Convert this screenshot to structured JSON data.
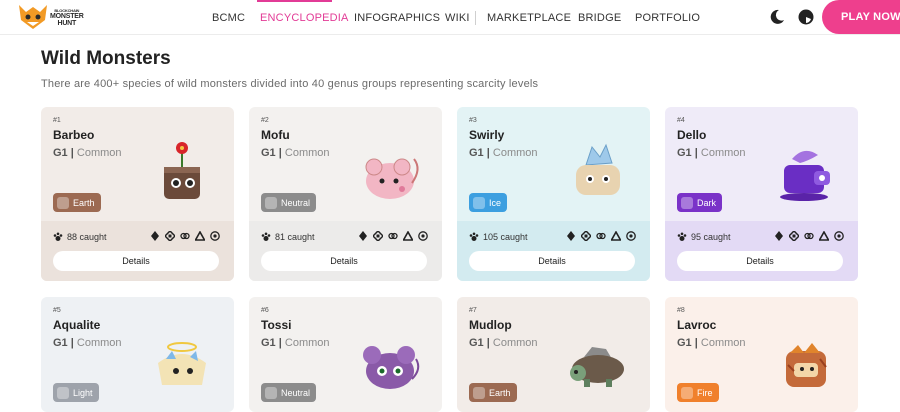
{
  "brand": {
    "logo_line1": "BLOCKCHAIN",
    "logo_line2": "MONSTER",
    "logo_line3": "HUNT"
  },
  "nav": {
    "links": [
      "BCMC",
      "ENCYCLOPEDIA",
      "INFOGRAPHICS",
      "WIKI",
      "MARKETPLACE",
      "BRIDGE",
      "PORTFOLIO"
    ],
    "active": "ENCYCLOPEDIA",
    "play_label": "PLAY NOW",
    "accent": "#e23b96"
  },
  "page": {
    "title": "Wild Monsters",
    "subtitle": "There are 400+ species of wild monsters divided into 40 genus groups representing scarcity levels"
  },
  "cards": [
    {
      "num": "#1",
      "name": "Barbeo",
      "genus": "G1",
      "rarity": "Common",
      "type": "Earth",
      "caught": "88 caught",
      "details": "Details",
      "bg": "#f2ece8",
      "footer": "#ebe2dc",
      "badge": "#9c6a52"
    },
    {
      "num": "#2",
      "name": "Mofu",
      "genus": "G1",
      "rarity": "Common",
      "type": "Neutral",
      "caught": "81 caught",
      "details": "Details",
      "bg": "#f3f1ef",
      "footer": "#ecebea",
      "badge": "#8c8c8c"
    },
    {
      "num": "#3",
      "name": "Swirly",
      "genus": "G1",
      "rarity": "Common",
      "type": "Ice",
      "caught": "105 caught",
      "details": "Details",
      "bg": "#e3f3f5",
      "footer": "#d3ebf0",
      "badge": "#3d9fe0"
    },
    {
      "num": "#4",
      "name": "Dello",
      "genus": "G1",
      "rarity": "Common",
      "type": "Dark",
      "caught": "95 caught",
      "details": "Details",
      "bg": "#efebf8",
      "footer": "#e3daf5",
      "badge": "#7a32c8"
    },
    {
      "num": "#5",
      "name": "Aqualite",
      "genus": "G1",
      "rarity": "Common",
      "type": "Light",
      "caught": "",
      "details": "",
      "bg": "#eef1f4",
      "footer": "#e6eaef",
      "badge": "#9ea3ab"
    },
    {
      "num": "#6",
      "name": "Tossi",
      "genus": "G1",
      "rarity": "Common",
      "type": "Neutral",
      "caught": "",
      "details": "",
      "bg": "#f3f1ef",
      "footer": "#ecebea",
      "badge": "#8c8c8c"
    },
    {
      "num": "#7",
      "name": "Mudlop",
      "genus": "G1",
      "rarity": "Common",
      "type": "Earth",
      "caught": "",
      "details": "",
      "bg": "#f2ece8",
      "footer": "#ebe2dc",
      "badge": "#9c6a52"
    },
    {
      "num": "#8",
      "name": "Lavroc",
      "genus": "G1",
      "rarity": "Common",
      "type": "Fire",
      "caught": "",
      "details": "",
      "bg": "#fbf0ea",
      "footer": "#f7e4da",
      "badge": "#f0802c"
    }
  ]
}
